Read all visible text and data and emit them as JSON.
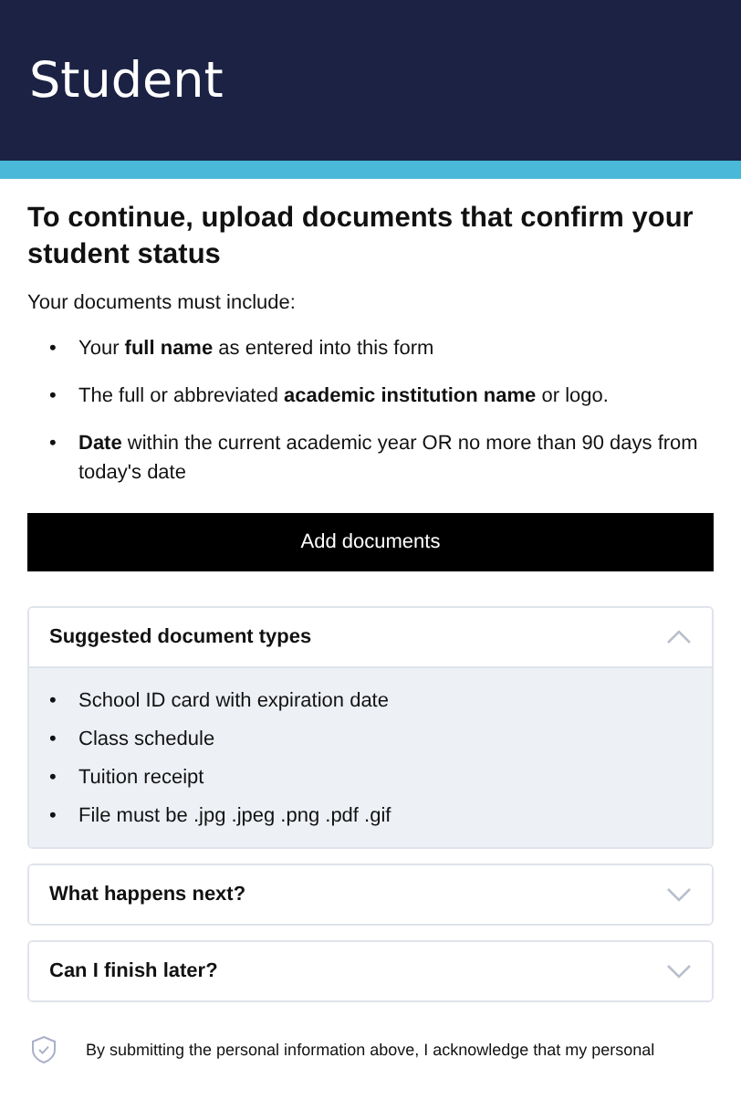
{
  "header": {
    "title": "Student"
  },
  "heading": "To continue, upload documents that confirm your student status",
  "intro": "Your documents must include:",
  "bullet": "•",
  "requirements": [
    "Your **full name** as entered into this form",
    "The full or abbreviated **academic institution name** or logo.",
    "**Date** within the current academic year OR no more than 90 days from today's date"
  ],
  "add_button": "Add documents",
  "accordions": [
    {
      "title": "Suggested document types",
      "expanded": true,
      "items": [
        "School ID card with expiration date",
        "Class schedule",
        "Tuition receipt",
        "File must be .jpg .jpeg .png .pdf .gif"
      ]
    },
    {
      "title": "What happens next?",
      "expanded": false
    },
    {
      "title": "Can I finish later?",
      "expanded": false
    }
  ],
  "footer": {
    "text": "By submitting the personal information above, I acknowledge that my personal"
  }
}
